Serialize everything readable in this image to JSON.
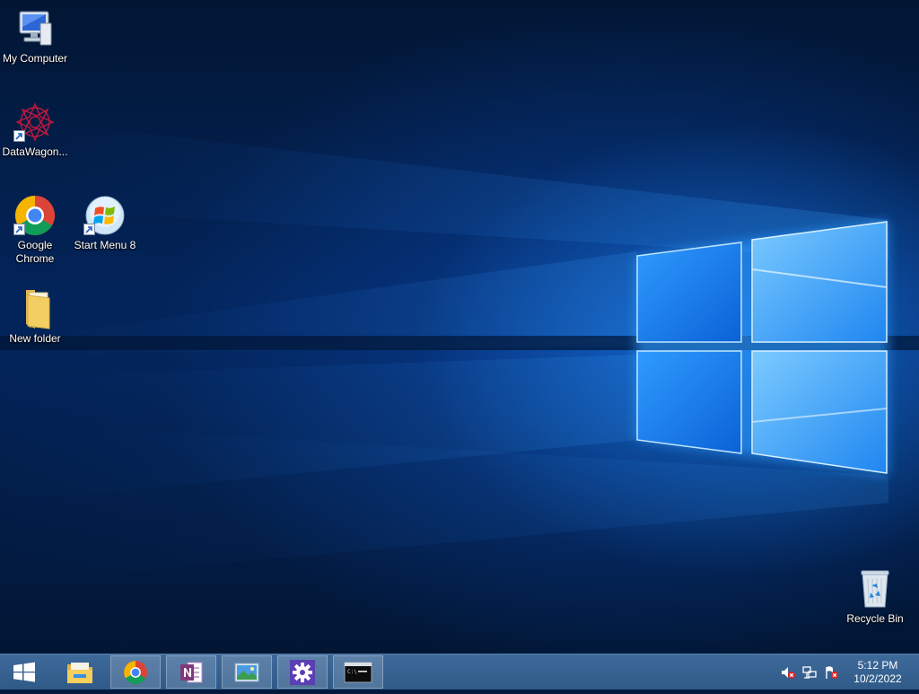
{
  "desktop": {
    "icons": [
      {
        "label": "My Computer",
        "icon": "computer-icon"
      },
      {
        "label": "DataWagon...",
        "icon": "datawagon-icon"
      },
      {
        "label": "Google Chrome",
        "icon": "chrome-icon"
      },
      {
        "label": "Start Menu 8",
        "icon": "start-menu-8-icon"
      },
      {
        "label": "New folder",
        "icon": "folder-icon"
      },
      {
        "label": "Recycle Bin",
        "icon": "recycle-bin-icon"
      }
    ]
  },
  "taskbar": {
    "pinned": [
      {
        "icon": "file-explorer-icon"
      },
      {
        "icon": "chrome-icon"
      },
      {
        "icon": "onenote-icon"
      },
      {
        "icon": "photos-icon"
      },
      {
        "icon": "settings-icon"
      },
      {
        "icon": "command-prompt-icon"
      }
    ],
    "tray": {
      "icons": [
        "volume-muted-icon",
        "network-icon",
        "action-center-flag-icon"
      ],
      "time": "5:12 PM",
      "date": "10/2/2022"
    },
    "colors": {
      "bar": "#2f5a88",
      "accent": "#1e8cff"
    }
  }
}
